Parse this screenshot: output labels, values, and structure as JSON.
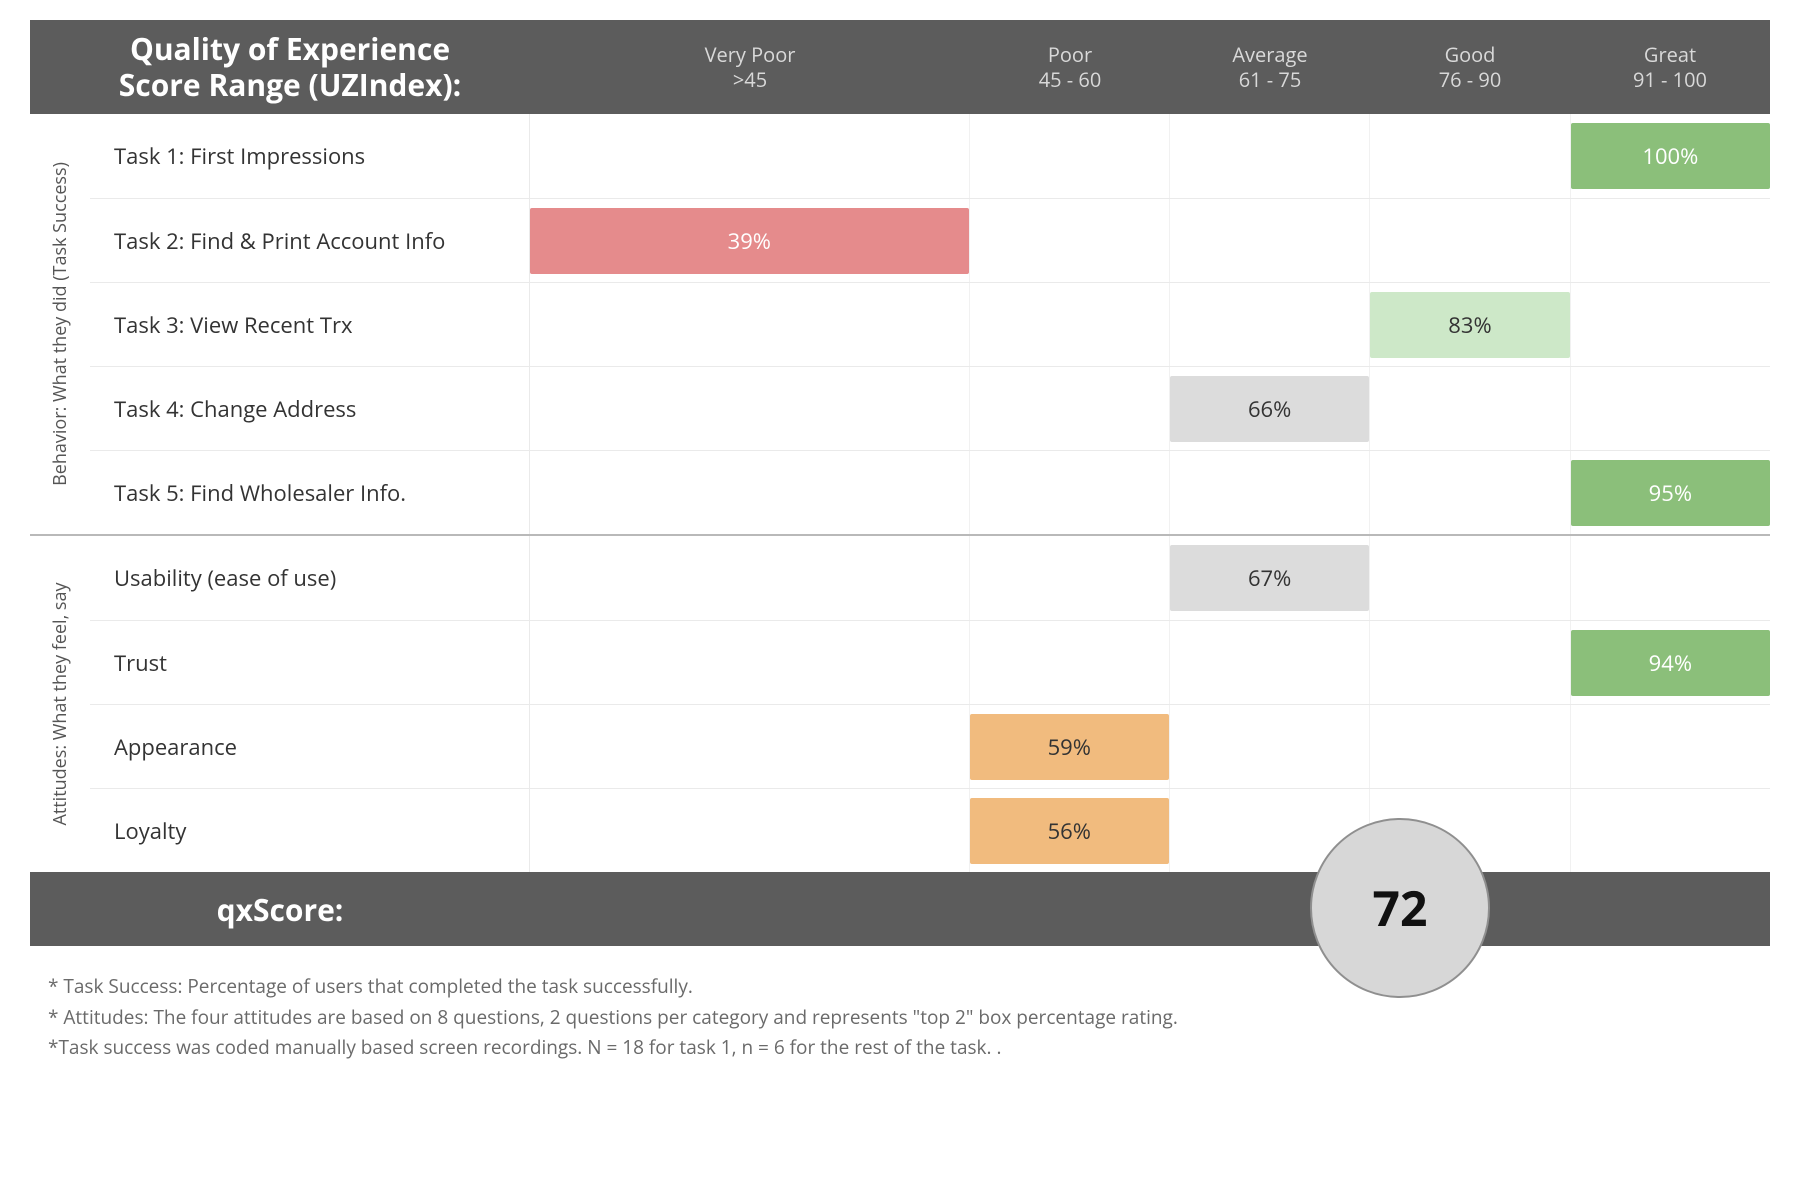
{
  "header": {
    "title_line1": "Quality of Experience",
    "title_line2": "Score Range (UZIndex):",
    "ticks": [
      {
        "name": "Very Poor",
        "range": ">45"
      },
      {
        "name": "Poor",
        "range": "45 - 60"
      },
      {
        "name": "Average",
        "range": "61 - 75"
      },
      {
        "name": "Good",
        "range": "76 - 90"
      },
      {
        "name": "Great",
        "range": "91 - 100"
      }
    ]
  },
  "section_labels": {
    "behavior": "Behavior: What they did (Task Success)",
    "attitudes": "Attitudes: What they feel, say"
  },
  "chart_data": {
    "type": "table",
    "title": "Quality of Experience Score Range (UZIndex)",
    "columns": [
      "Very Poor >45",
      "Poor 45-60",
      "Average 61-75",
      "Good 76-90",
      "Great 91-100"
    ],
    "footer_score_label": "qxScore:",
    "footer_score_value": "72",
    "colors": {
      "very_poor": "#e58b8c",
      "poor": "#f1bb7e",
      "average": "#dcdcdc",
      "good": "#cde8c8",
      "great": "#8bbf7a"
    },
    "sections": [
      {
        "name": "behavior",
        "rows": [
          {
            "label": "Task 1: First Impressions",
            "value": "100%",
            "bucket": 4
          },
          {
            "label": "Task 2: Find & Print Account Info",
            "value": "39%",
            "bucket": 0
          },
          {
            "label": "Task 3: View Recent Trx",
            "value": "83%",
            "bucket": 3
          },
          {
            "label": "Task 4: Change Address",
            "value": "66%",
            "bucket": 2
          },
          {
            "label": "Task 5: Find Wholesaler Info.",
            "value": "95%",
            "bucket": 4
          }
        ]
      },
      {
        "name": "attitudes",
        "rows": [
          {
            "label": "Usability (ease of use)",
            "value": "67%",
            "bucket": 2
          },
          {
            "label": "Trust",
            "value": "94%",
            "bucket": 4
          },
          {
            "label": "Appearance",
            "value": "59%",
            "bucket": 1
          },
          {
            "label": "Loyalty",
            "value": "56%",
            "bucket": 1
          }
        ]
      }
    ]
  },
  "footnotes": [
    "* Task Success: Percentage of users that completed the task successfully.",
    "* Attitudes: The four attitudes are based on 8 questions, 2 questions per category and represents \"top 2\" box percentage rating.",
    "*Task success was coded manually based screen recordings.  N = 18 for task 1, n = 6 for the rest of the task. ."
  ]
}
